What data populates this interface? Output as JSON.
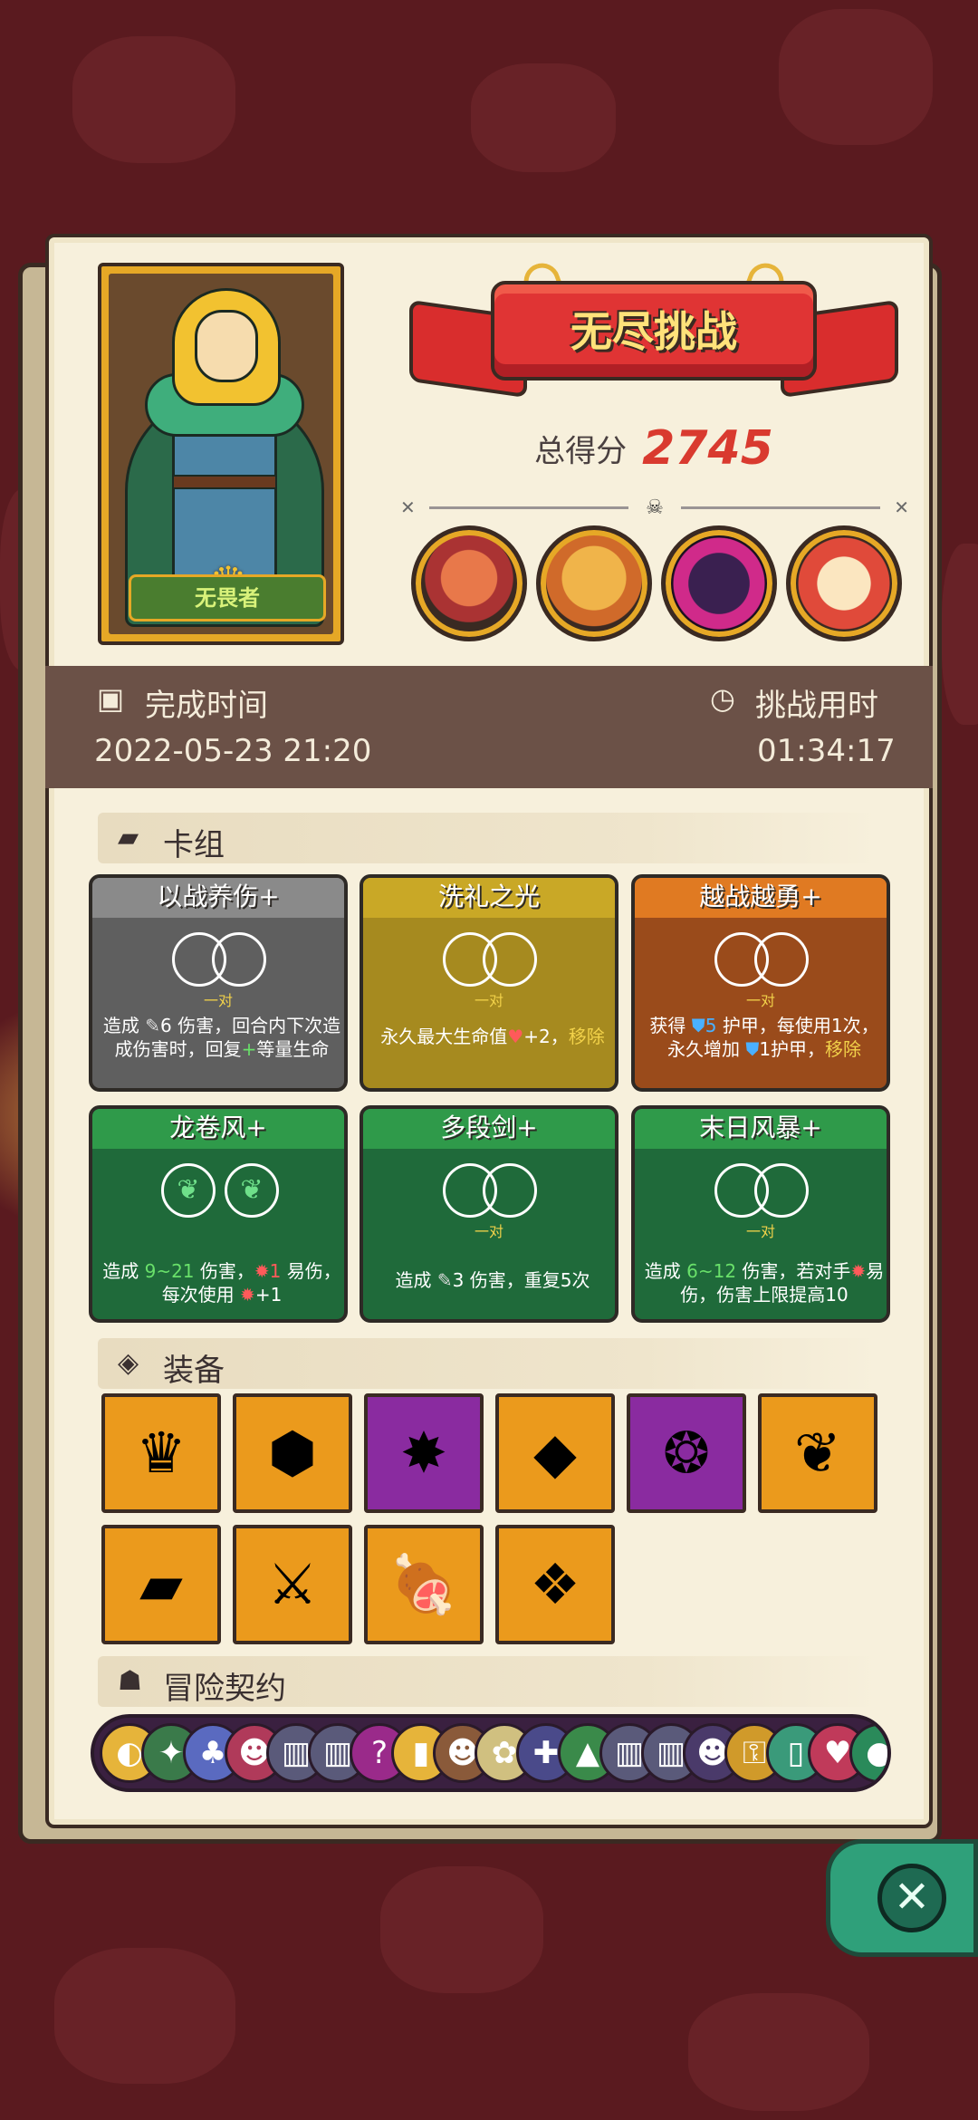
{
  "hero": {
    "title": "无畏者"
  },
  "banner": {
    "title": "无尽挑战"
  },
  "score": {
    "label": "总得分",
    "value": "2745"
  },
  "time": {
    "finish_label": "完成时间",
    "finish_value": "2022-05-23 21:20",
    "duration_label": "挑战用时",
    "duration_value": "01:34:17"
  },
  "deck": {
    "title": "卡组",
    "cards": [
      {
        "name": "以战养伤+",
        "sub": "一对",
        "desc": [
          "造成 ",
          "6",
          " 伤害，回合内下次造成伤害时，回复",
          "+",
          "等量生命"
        ]
      },
      {
        "name": "洗礼之光",
        "sub": "一对",
        "desc": [
          "永久最大生命值",
          "+2，",
          "移除"
        ]
      },
      {
        "name": "越战越勇+",
        "sub": "一对",
        "desc": [
          "获得 ",
          "5",
          " 护甲，每使用1次，永久增加 ",
          "1护甲，",
          "移除"
        ]
      },
      {
        "name": "龙卷风+",
        "sub": "",
        "desc": [
          "造成 ",
          "9~21",
          " 伤害，",
          "1",
          " 易伤，每次使用 ",
          "+1"
        ]
      },
      {
        "name": "多段剑+",
        "sub": "一对",
        "desc": [
          "造成 ",
          "3",
          " 伤害，重复5次"
        ]
      },
      {
        "name": "末日风暴+",
        "sub": "一对",
        "desc": [
          "造成 ",
          "6~12",
          " 伤害，若对手",
          "易伤，伤害上限提高10"
        ]
      }
    ]
  },
  "equipment": {
    "title": "装备",
    "items": [
      {
        "icon": "crown-icon",
        "glyph": "♛",
        "color": "gold"
      },
      {
        "icon": "green-stone-icon",
        "glyph": "⬢",
        "color": "gold"
      },
      {
        "icon": "ghost-scribble-icon",
        "glyph": "✸",
        "color": "purple"
      },
      {
        "icon": "blue-crystal-icon",
        "glyph": "◆",
        "color": "gold"
      },
      {
        "icon": "spiked-bracelet-icon",
        "glyph": "❂",
        "color": "purple"
      },
      {
        "icon": "green-plant-icon",
        "glyph": "❦",
        "color": "gold"
      },
      {
        "icon": "moss-rock-icon",
        "glyph": "▰",
        "color": "gold"
      },
      {
        "icon": "blue-dagger-icon",
        "glyph": "⚔",
        "color": "gold"
      },
      {
        "icon": "meat-icon",
        "glyph": "🍖",
        "color": "gold"
      },
      {
        "icon": "jeweled-mask-icon",
        "glyph": "❖",
        "color": "gold"
      }
    ]
  },
  "contract": {
    "title": "冒险契约",
    "icons": [
      "lemon-icon",
      "green-bird-icon",
      "mushroom-icon",
      "monster-mouth-icon",
      "stone-tablet-icon",
      "stone-tablet-icon",
      "purple-question-icon",
      "yellow-bottle-icon",
      "brown-cat-icon",
      "bag-icon",
      "shield-cross-icon",
      "green-helmet-icon",
      "stone-tablet-icon",
      "stone-tablet-icon",
      "dark-cat-icon",
      "gold-key-icon",
      "potion-icon",
      "heart-bow-icon",
      "green-ball-icon"
    ]
  },
  "colors": {
    "accent_red": "#d93a2f",
    "panel_brown": "#6b5147",
    "gold": "#eb9a1c",
    "purple": "#8a2ba0"
  }
}
